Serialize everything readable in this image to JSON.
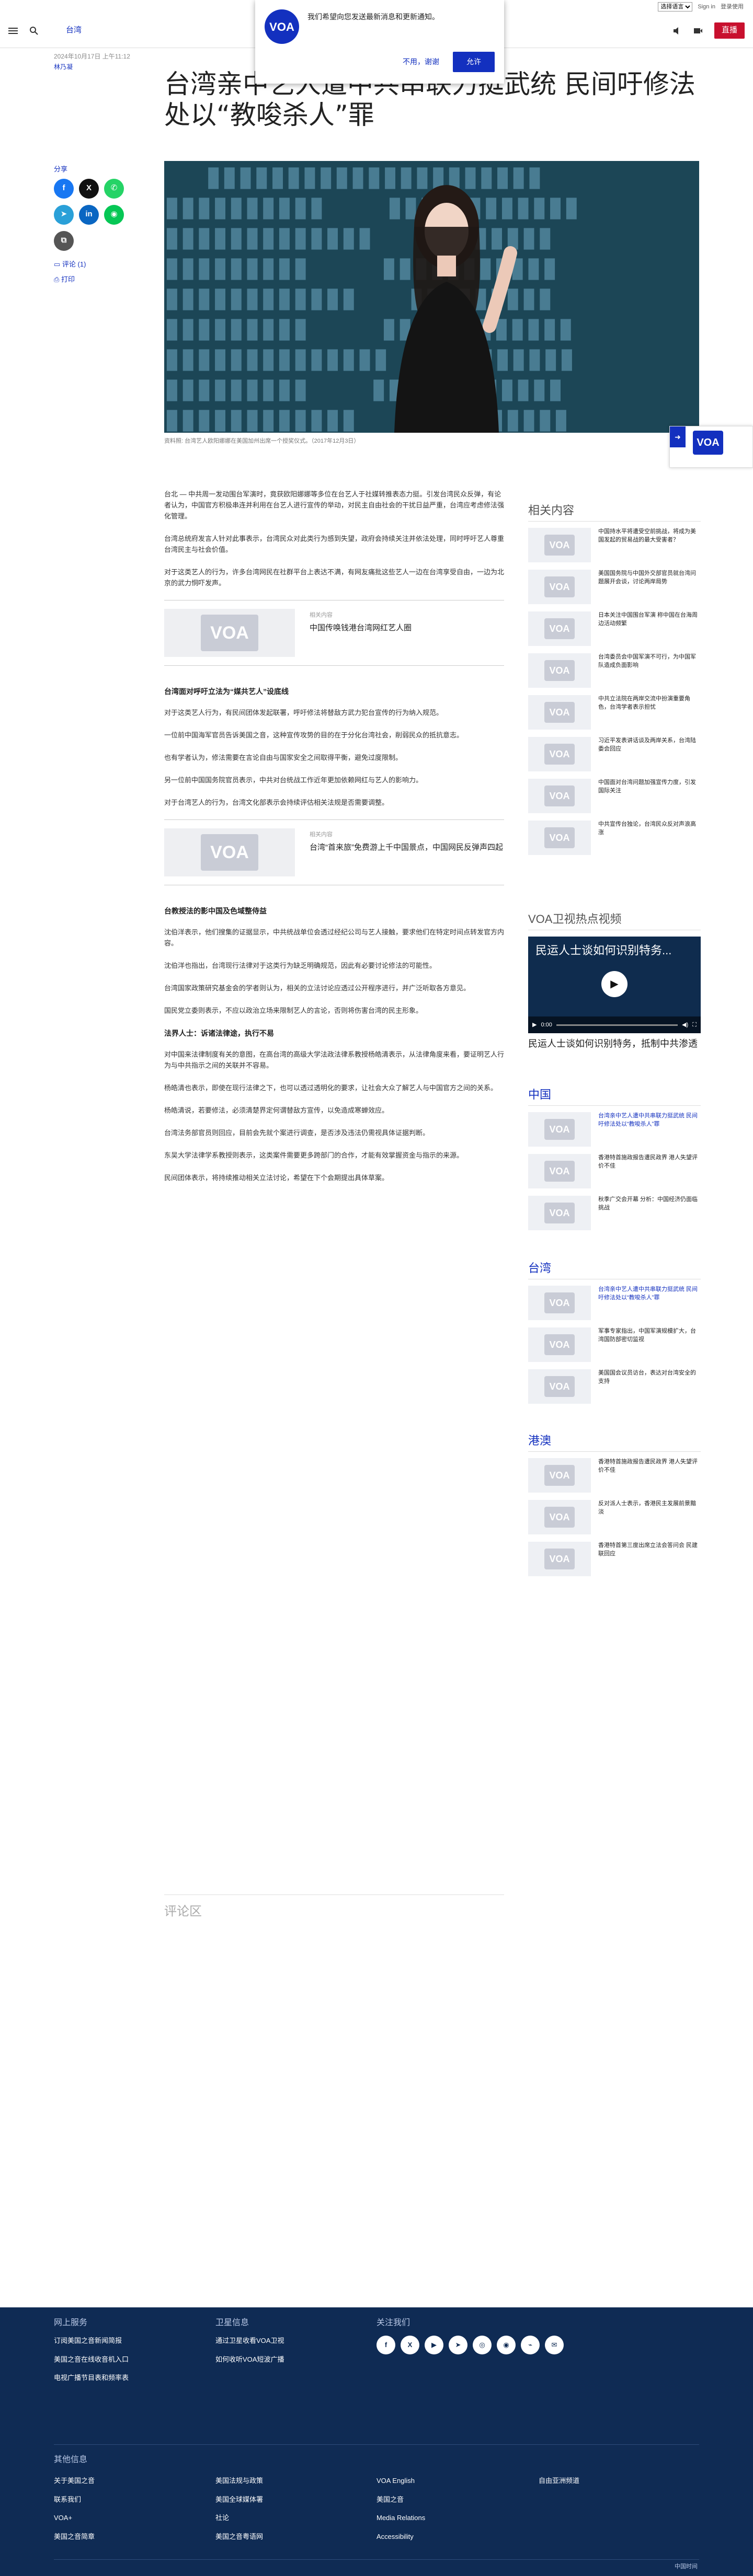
{
  "topbar": {
    "language_select": "选择语言",
    "signin": "Sign in",
    "profile_text": "登录使用"
  },
  "header": {
    "section": "台湾",
    "live_label": "直播"
  },
  "popup": {
    "message": "我们希望向您发送最新消息和更新通知。",
    "decline": "不用，谢谢",
    "accept": "允许"
  },
  "logo": {
    "text": "VOA"
  },
  "article": {
    "date": "2024年10月17日 上午11:12",
    "author": "林乃凝",
    "title": "台湾亲中艺人遭中共串联力挺武统 民间吁修法处以“教唆杀人”罪",
    "caption": "资料照: 台湾艺人欧阳娜娜在美国加州出席一个授奖仪式。（2017年12月3日）",
    "paragraphs": [
      "台北 — 中共周一发动围台军演时，竟获欧阳娜娜等多位在台艺人于社媒转推表态力挺。引发台湾民众反弹，有论者认为，中国官方积极串连并利用在台艺人进行宣传的举动，对民主自由社会的干扰日益严重，台湾应考虑修法强化管理。",
      "台湾总统府发言人针对此事表示，台湾民众对此类行为感到失望，政府会持续关注并依法处理，同时呼吁艺人尊重台湾民主与社会价值。",
      "对于这类艺人的行为，许多台湾网民在社群平台上表达不满，有网友痛批这些艺人一边在台湾享受自由，一边为北京的武力恫吓发声。"
    ],
    "related1": {
      "label": "相关内容",
      "title": "中国传唤钱港台湾网红艺人圈"
    },
    "h3_1": "台湾面对呼吁立法为“媒共艺人”设底线",
    "paragraphs2": [
      "对于这类艺人行为，有民间团体发起联署，呼吁修法将替敌方武力犯台宣传的行为纳入规范。",
      "一位前中国海军官员告诉美国之音，这种宣传攻势的目的在于分化台湾社会，削弱民众的抵抗意志。",
      "也有学者认为，修法需要在言论自由与国家安全之间取得平衡，避免过度限制。",
      "另一位前中国国务院官员表示，中共对台统战工作近年更加依赖网红与艺人的影响力。",
      "对于台湾艺人的行为，台湾文化部表示会持续评估相关法规是否需要调整。"
    ],
    "related2": {
      "label": "相关内容",
      "title": "台湾“首来旅”免费游上千中国景点，中国网民反弹声四起"
    },
    "h3_2": "台教授法的影中国及色域整侍益",
    "paragraphs3": [
      "沈伯洋表示，他们搜集的证据显示，中共统战单位会透过经纪公司与艺人接触，要求他们在特定时间点转发官方内容。",
      "沈伯洋也指出，台湾现行法律对于这类行为缺乏明确规范，因此有必要讨论修法的可能性。",
      "台湾国家政策研究基金会的学者则认为，相关的立法讨论应透过公开程序进行，并广泛听取各方意见。",
      "国民党立委则表示，不应以政治立场来限制艺人的言论，否则将伤害台湾的民主形象。"
    ],
    "h3_3": "法界人士：诉诸法律途，执行不易",
    "paragraphs4": [
      "对中国来法律制度有关的意图，在高台湾的高级大学法政法律系教授杨皓清表示，从法律角度来看，要证明艺人行为与中共指示之间的关联并不容易。",
      "杨皓清也表示，即使在现行法律之下，也可以透过透明化的要求，让社会大众了解艺人与中国官方之间的关系。",
      "杨皓清说，若要修法，必须清楚界定何谓替敌方宣传，以免造成寒蝉效应。",
      "台湾法务部官员则回应，目前会先就个案进行调查，是否涉及违法仍需视具体证据判断。",
      "东吴大学法律学系教授则表示，这类案件需要更多跨部门的合作，才能有效掌握资金与指示的来源。",
      "民间团体表示，将持续推动相关立法讨论，希望在下个会期提出具体草案。"
    ],
    "comments_section": "评论区"
  },
  "share": {
    "label": "分享",
    "comments": "评论 (1)",
    "print": "打印"
  },
  "sidebar": {
    "related_heading": "相关内容",
    "related_items": [
      "中国持水平将遭受空前挑战，将成为美国发起的贸易战的最大受害者？",
      "美国国务院与中国外交部官员就台湾问题展开会谈，讨论两岸局势",
      "日本关注中国围台军演 称中国在台海周边活动频繁",
      "台湾委员会中国军演不可行，为中国军队造成负面影响",
      "中共立法院在两岸交流中扮演重要角色，台湾学者表示担忧",
      "习近平发表讲话谈及两岸关系，台湾陆委会回应",
      "中国面对台湾问题加强宣传力度，引发国际关注",
      "中共宣传台独论，台湾民众反对声浪高涨"
    ],
    "video_heading": "VOA卫视热点视频",
    "video_title_overlay": "民运人士谈如何识别特务...",
    "video_caption": "民运人士谈如何识别特务，抵制中共渗透",
    "video_time": "0:00",
    "china_heading": "中国",
    "china_items": [
      "台湾亲中艺人遭中共串联力挺武统 民间吁修法处以“教唆杀人”罪",
      "香港特首施政报告遭民政界 港人失望评价不佳",
      "秋季广交会开幕 分析：中国经济仍面临挑战"
    ],
    "taiwan_heading": "台湾",
    "taiwan_items": [
      "台湾亲中艺人遭中共串联力挺武统 民间吁修法处以“教唆杀人”罪",
      "军事专家指出，中国军演规模扩大，台湾国防部密切监视",
      "美国国会议员访台，表达对台湾安全的支持"
    ],
    "hk_heading": "港澳",
    "hk_items": [
      "香港特首施政报告遭民政界 港人失望评价不佳",
      "反对派人士表示，香港民主发展前景黯淡",
      "香港特首第三度出席立法会答问会 民建联回应"
    ]
  },
  "footer": {
    "col1_heading": "网上服务",
    "col1_links": [
      "订阅美国之音新闻简报",
      "美国之音在线收音机入口",
      "电视广播节目表和频率表"
    ],
    "col2_heading": "卫星信息",
    "col2_links": [
      "通过卫星收看VOA卫视",
      "如何收听VOA短波广播"
    ],
    "col3_heading": "关注我们",
    "more_heading": "其他信息",
    "more_links_a": [
      "关于美国之音",
      "联系我们",
      "VOA+",
      "美国之音简章"
    ],
    "more_links_b": [
      "美国法规与政策",
      "美国全球媒体署",
      "社论",
      "美国之音粤语网"
    ],
    "more_links_c": [
      "VOA English",
      "美国之音",
      "Media Relations",
      "Accessibility"
    ],
    "more_links_d": [
      "自由亚洲频道"
    ],
    "bottom": "中国时间"
  }
}
